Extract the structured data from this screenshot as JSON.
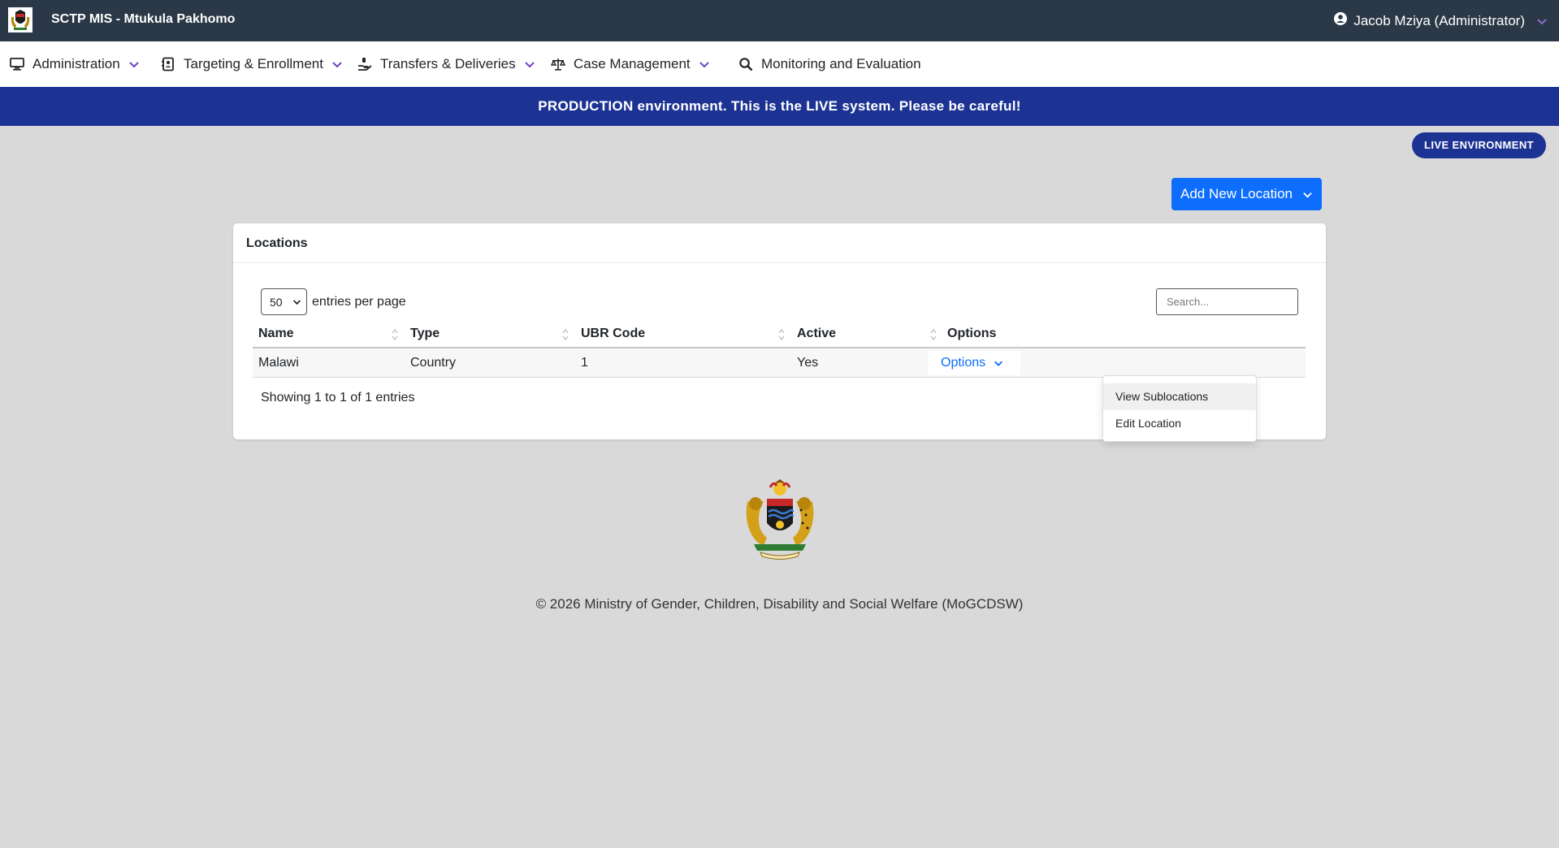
{
  "app": {
    "title": "SCTP MIS - Mtukula Pakhomo"
  },
  "user": {
    "name": "Jacob Mziya (Administrator)"
  },
  "nav": [
    {
      "label": "Administration",
      "icon": "desktop-icon"
    },
    {
      "label": "Targeting & Enrollment",
      "icon": "address-book-icon"
    },
    {
      "label": "Transfers & Deliveries",
      "icon": "hand-holding-icon"
    },
    {
      "label": "Case Management",
      "icon": "scale-icon"
    },
    {
      "label": "Monitoring and Evaluation",
      "icon": "search-icon"
    }
  ],
  "banner": "PRODUCTION environment. This is the LIVE system. Please be careful!",
  "live_badge": "LIVE ENVIRONMENT",
  "add_button": "Add New Location",
  "card": {
    "title": "Locations",
    "page_size": "50",
    "entries_label": "entries per page",
    "search_placeholder": "Search...",
    "columns": [
      "Name",
      "Type",
      "UBR Code",
      "Active",
      "Options"
    ],
    "rows": [
      {
        "name": "Malawi",
        "type": "Country",
        "ubr_code": "1",
        "active": "Yes",
        "options_label": "Options"
      }
    ],
    "showing": "Showing 1 to 1 of 1 entries"
  },
  "dropdown": {
    "items": [
      "View Sublocations",
      "Edit Location"
    ]
  },
  "footer": "© 2026 Ministry of Gender, Children, Disability and Social Welfare (MoGCDSW)",
  "colors": {
    "topbar": "#2b3847",
    "banner": "#1d3394",
    "primary": "#0d6efd",
    "chevron": "#6f42c1"
  }
}
